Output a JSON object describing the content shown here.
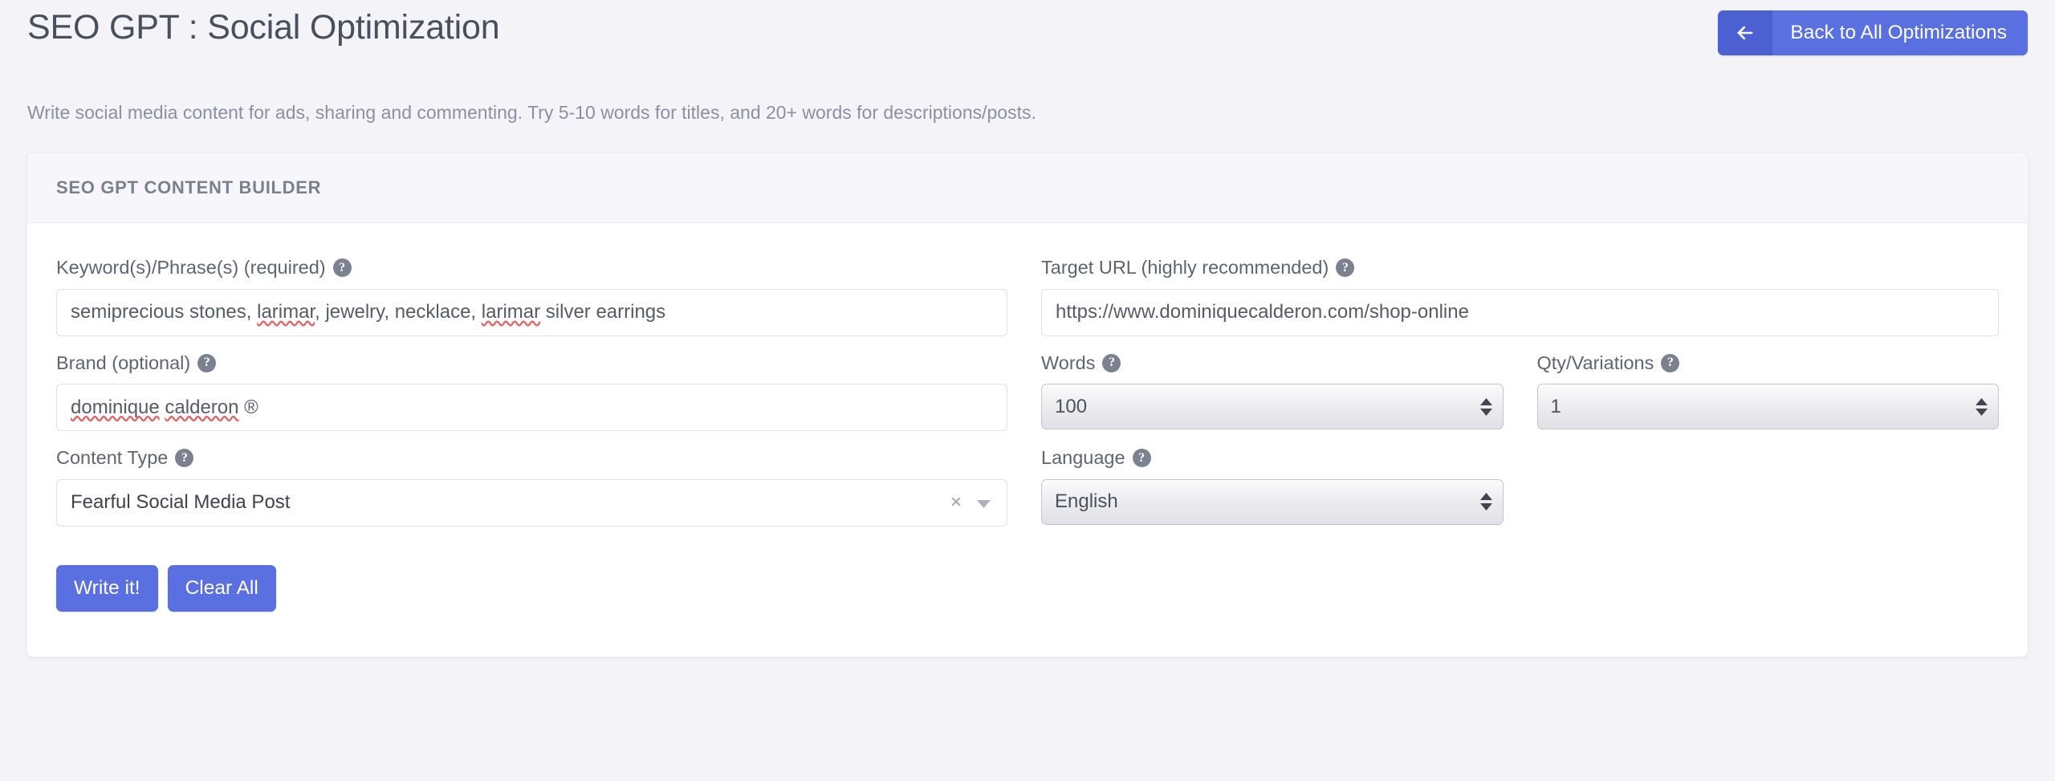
{
  "header": {
    "title": "SEO GPT : Social Optimization",
    "subtitle": "Write social media content for ads, sharing and commenting. Try 5-10 words for titles, and 20+ words for descriptions/posts.",
    "back_button": {
      "label": "Back to All Optimizations",
      "icon": "arrow-left-icon"
    }
  },
  "card": {
    "title": "SEO GPT CONTENT BUILDER",
    "fields": {
      "keywords": {
        "label": "Keyword(s)/Phrase(s) (required)",
        "help_icon": "help-circle-icon",
        "value": "semiprecious stones, larimar, jewelry, necklace, larimar silver earrings",
        "placeholder": "",
        "misspelled": [
          "larimar"
        ]
      },
      "target_url": {
        "label": "Target URL (highly recommended)",
        "help_icon": "help-circle-icon",
        "value": "https://www.dominiquecalderon.com/shop-online",
        "placeholder": ""
      },
      "brand": {
        "label": "Brand (optional)",
        "help_icon": "help-circle-icon",
        "value": "dominique calderon ®",
        "placeholder": "",
        "misspelled": [
          "dominique",
          "calderon"
        ]
      },
      "words": {
        "label": "Words",
        "help_icon": "help-circle-icon",
        "value": "100",
        "control": "number-stepper"
      },
      "qty_variations": {
        "label": "Qty/Variations",
        "help_icon": "help-circle-icon",
        "value": "1",
        "control": "number-stepper"
      },
      "content_type": {
        "label": "Content Type",
        "help_icon": "help-circle-icon",
        "value": "Fearful Social Media Post",
        "clear_icon": "close-icon",
        "caret_icon": "chevron-down-icon"
      },
      "language": {
        "label": "Language",
        "help_icon": "help-circle-icon",
        "value": "English",
        "control": "select"
      }
    },
    "actions": {
      "write": "Write it!",
      "clear": "Clear All"
    }
  },
  "colors": {
    "page_background": "#f4f4f8",
    "accent_blue": "#5a6fe0",
    "accent_blue_dark": "#4c60d2",
    "card_header_background": "#f7f7fb",
    "text_primary": "#4a4f5e",
    "text_muted": "#8b8fa0",
    "spellcheck_underline": "#e06464"
  }
}
